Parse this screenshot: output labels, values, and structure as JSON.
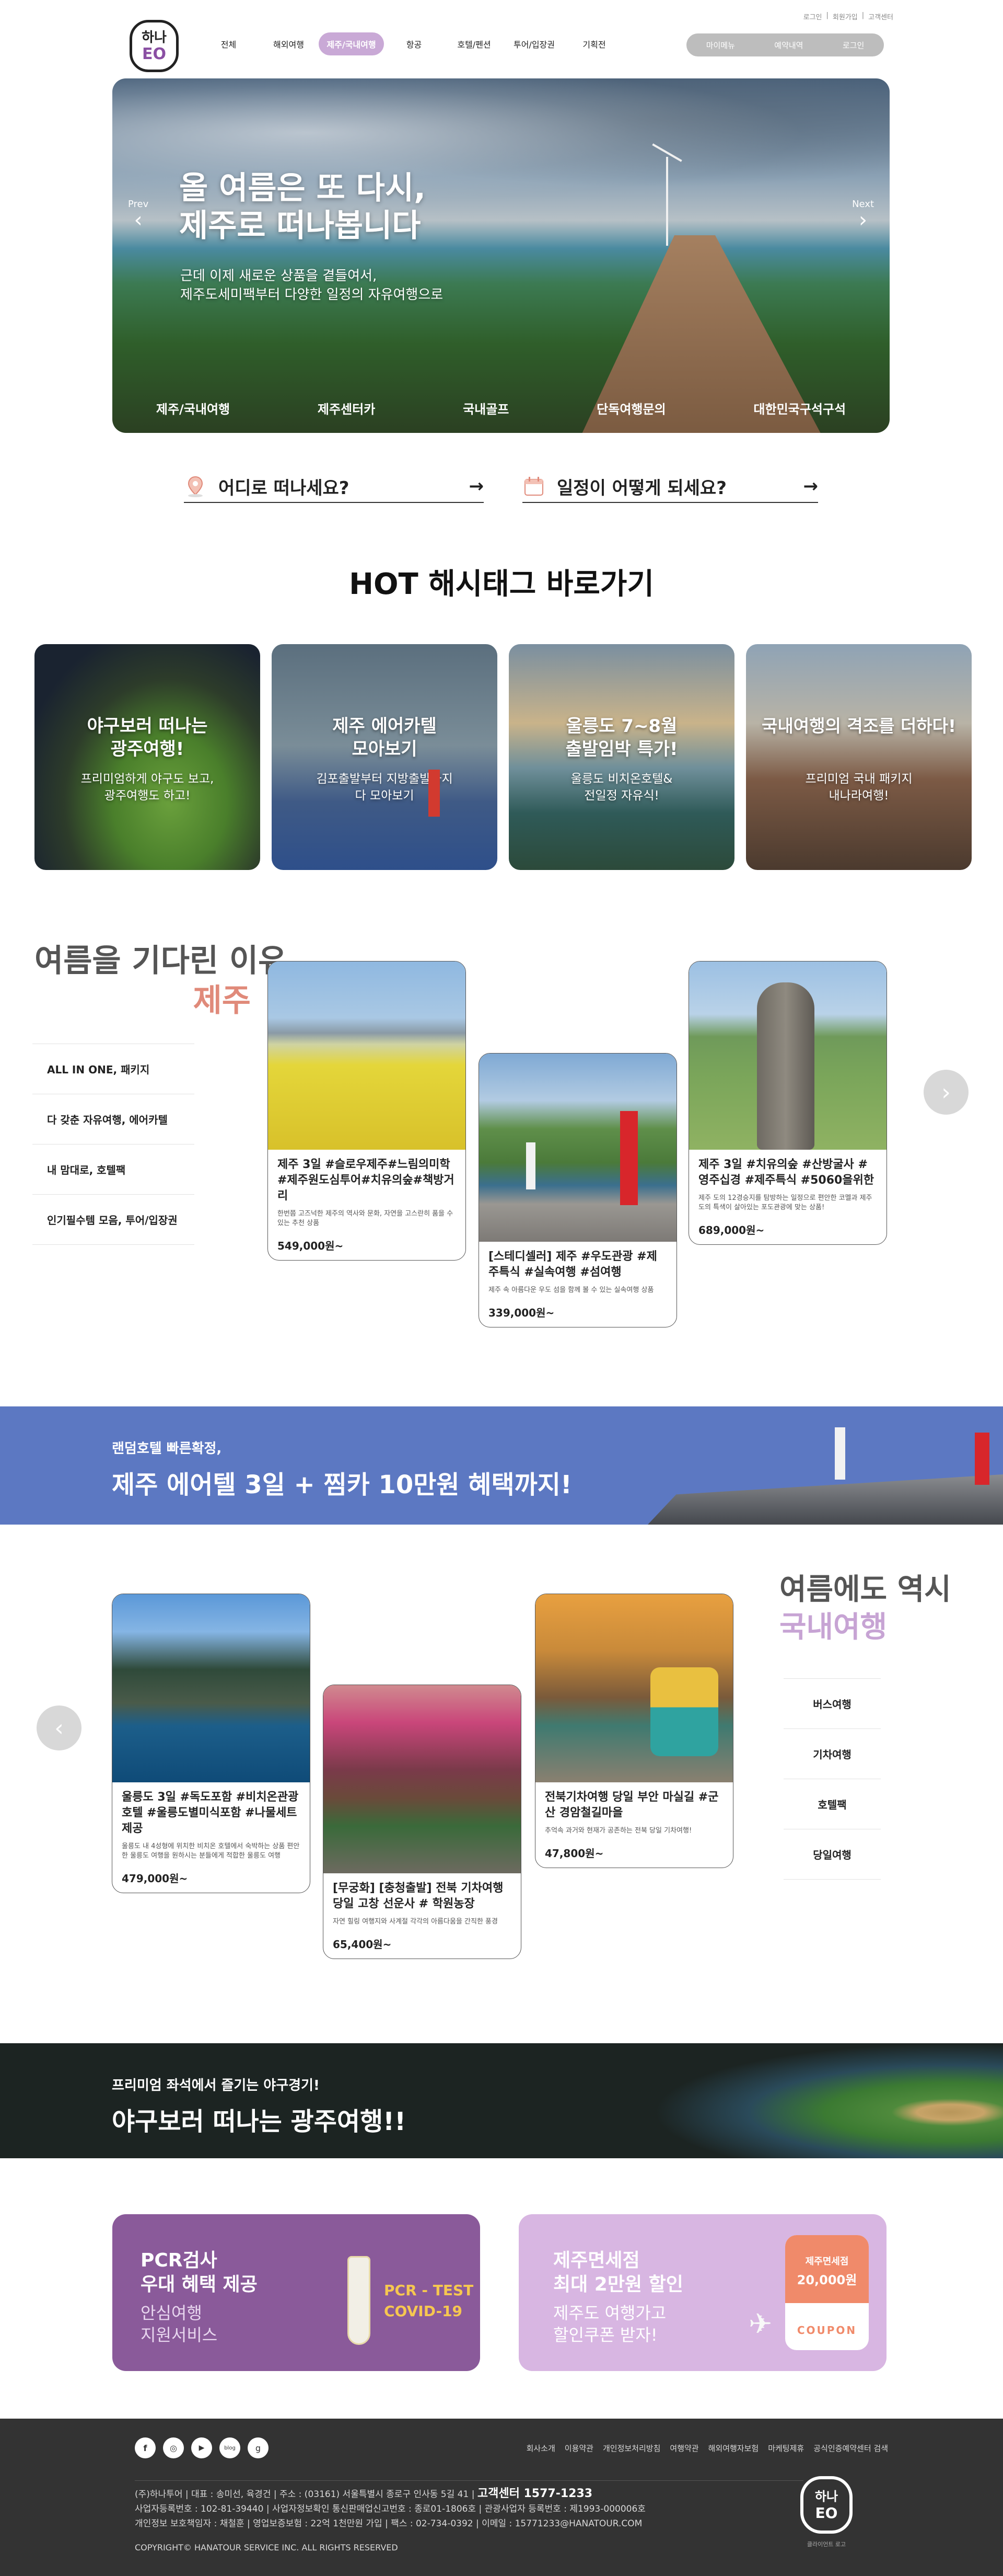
{
  "header": {
    "top_links": [
      "로그인",
      "회원가입",
      "고객센터"
    ],
    "logo_text": [
      "하나",
      "E",
      "O"
    ],
    "nav": [
      "전체",
      "해외여행",
      "제주/국내여행",
      "항공",
      "호텔/펜션",
      "투어/입장권",
      "기획전"
    ],
    "nav_active_index": 2,
    "right_buttons": [
      "마이메뉴",
      "예약내역",
      "로그인"
    ]
  },
  "hero": {
    "title_line1": "올 여름은 또 다시,",
    "title_line2": "제주로 떠나봅니다",
    "sub_line1": "근데 이제 새로운 상품을 곁들여서,",
    "sub_line2": "제주도세미팩부터 다양한 일정의 자유여행으로",
    "prev": "Prev",
    "next": "Next",
    "tabs": [
      "제주/국내여행",
      "제주센터카",
      "국내골프",
      "단독여행문의",
      "대한민국구석구석"
    ]
  },
  "search": {
    "where": "어디로 떠나세요?",
    "when": "일정이 어떻게 되세요?"
  },
  "hashtag": {
    "title": "HOT 해시태그 바로가기",
    "cards": [
      {
        "title1": "야구보러 떠나는",
        "title2": "광주여행!",
        "sub1": "프리미엄하게 야구도 보고,",
        "sub2": "광주여행도 하고!"
      },
      {
        "title1": "제주 에어카텔",
        "title2": "모아보기",
        "sub1": "김포출발부터 지방출발까지",
        "sub2": "다 모아보기"
      },
      {
        "title1": "울릉도 7~8월",
        "title2": "출발임박 특가!",
        "sub1": "울릉도 비치온호텔&",
        "sub2": "전일정 자유식!"
      },
      {
        "title1": "국내여행의 격조를 더하다!",
        "title2": "",
        "sub1": "프리미엄 국내 패키지",
        "sub2": "내나라여행!"
      }
    ]
  },
  "jeju": {
    "title1": "여름을 기다린 이유,",
    "title2": "제주",
    "accent_color": "#e08a7a",
    "categories": [
      "ALL IN ONE, 패키지",
      "다 갖춘 자유여행, 에어카텔",
      "내 맘대로, 호텔팩",
      "인기필수템 모음, 투어/입장권"
    ],
    "products": [
      {
        "title": "제주 3일 #슬로우제주#느림의미학 #제주원도심투어#치유의숲#책방거리",
        "desc": "한번쯤 고즈넉한 제주의 역사와 문화, 자연을 고스란히 품을 수 있는 추천 상품",
        "price": "549,000원~"
      },
      {
        "title": "[스테디셀러] 제주 #우도관광 #제주특식 #실속여행 #섬여행",
        "desc": "제주 속 아름다운 우도 섬을 함께 볼 수 있는 실속여행 상품",
        "price": "339,000원~"
      },
      {
        "title": "제주 3일 #치유의숲 #산방굴사 #영주십경 #제주특식 #5060을위한",
        "desc": "제주 도의 12경승지를 탐방하는 일정으로 편안한 코멜과 제주도의 특색이 살아있는 포도관광에 맞는 상품!",
        "price": "689,000원~"
      }
    ]
  },
  "banner1": {
    "sub": "랜덤호텔 빠른확정,",
    "title": "제주 에어텔 3일 + 찜카 10만원 혜택까지!"
  },
  "domestic": {
    "title1": "여름에도 역시",
    "title2": "국내여행",
    "accent_color": "#c7a4d4",
    "categories": [
      "버스여행",
      "기차여행",
      "호텔팩",
      "당일여행"
    ],
    "products": [
      {
        "title": "울릉도 3일 #독도포함 #비치온관광호텔 #울릉도별미식포함 #나물세트제공",
        "desc": "울릉도 내 4성형에 위치한 비치온 호텔에서 숙박하는 상품 편안한 울릉도 여행을 원하시는 분들에게 적합한 울릉도 여행",
        "price": "479,000원~"
      },
      {
        "title": "[무궁화] [충청출발] 전북 기차여행 당일 고창 선운사 # 학원농장",
        "desc": "자연 힐링 여행지와 사계절 각각의 아름다움을 간직한 풍경",
        "price": "65,400원~"
      },
      {
        "title": "전북기차여행 당일 부안 마실길 #군산 경암철길마을",
        "desc": "추억속 과거와 현재가 공존하는 전북 당일 기차여행!",
        "price": "47,800원~"
      }
    ]
  },
  "banner2": {
    "sub": "프리미엄 좌석에서 즐기는 야구경기!",
    "title": "야구보러 떠나는 광주여행!!"
  },
  "promo1": {
    "title1": "PCR검사",
    "title2": "우대 혜택 제공",
    "sub1": "안심여행",
    "sub2": "지원서비스",
    "tag1": "PCR - TEST",
    "tag2": "COVID-19"
  },
  "promo2": {
    "title1": "제주면세점",
    "title2": "최대 2만원 할인",
    "sub1": "제주도 여행가고",
    "sub2": "할인쿠폰 받자!",
    "coupon_label": "제주면세점",
    "coupon_amount": "20,000원",
    "coupon_text": "COUPON"
  },
  "footer": {
    "social": [
      "f",
      "◎",
      "▶",
      "blog",
      "g"
    ],
    "links": [
      "회사소개",
      "이용약관",
      "개인정보처리방침",
      "여행약관",
      "해외여행자보험",
      "마케팅제휴",
      "공식인증예약센터 검색"
    ],
    "line1": "(주)하나투어 | 대표 : 송미선, 육경건 | 주소 : (03161) 서울특별시 종로구 인사동 5길 41 |",
    "call": "고객센터 1577-1233",
    "line2": "사업자등록번호 : 102-81-39440 | 사업자정보확인 통신판매업신고번호 : 종로01-1806호 | 관광사업자 등록번호 : 제1993-000006호",
    "line3": "개인정보 보호책임자 : 채철훈 | 영업보증보험 : 22억 1천만원 가입 | 팩스 : 02-734-0392 | 이메일 : 15771233@HANATOUR.COM",
    "copyright": "COPYRIGHT© HANATOUR SERVICE INC. ALL RIGHTS RESERVED",
    "logo_sub": "클라이언트 로고"
  }
}
